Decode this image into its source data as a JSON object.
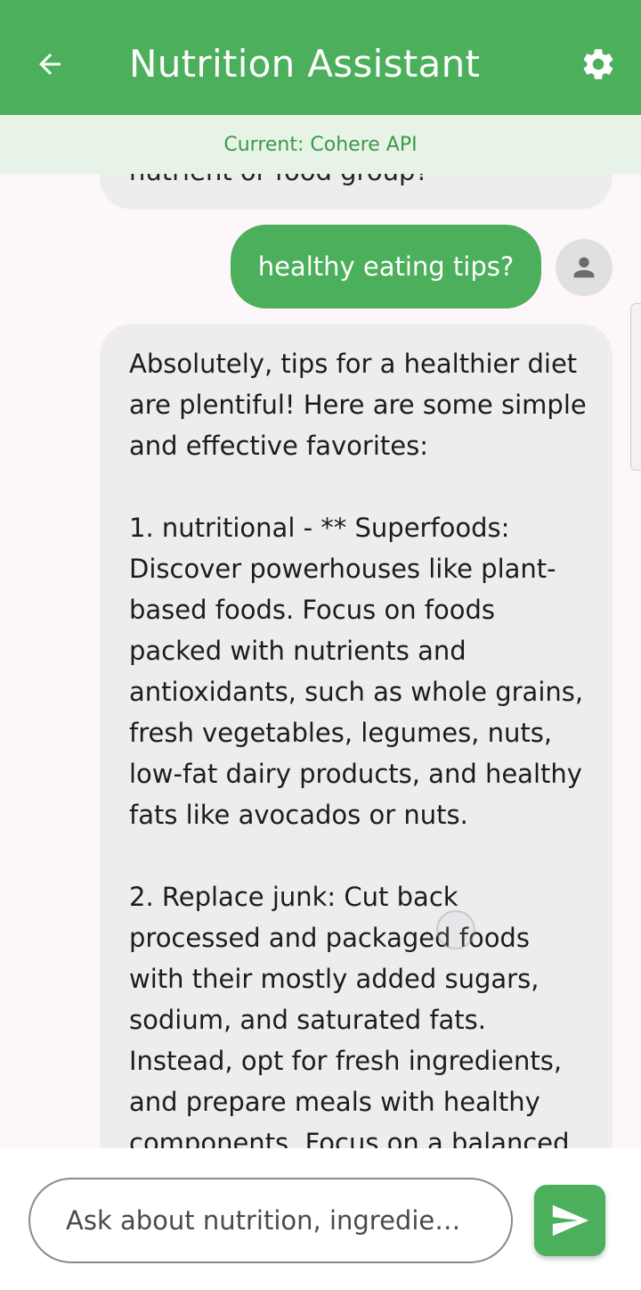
{
  "appbar": {
    "title": "Nutrition Assistant",
    "back_icon": "arrow-back-icon",
    "settings_icon": "gear-icon"
  },
  "status": {
    "text": "Current: Cohere API"
  },
  "chat": {
    "previous_bot_tail": "nutrient or food group?",
    "user_message": "healthy eating tips?",
    "avatar_icon": "person-icon",
    "bot_message": "Absolutely, tips for a healthier diet are plentiful! Here are some simple and effective favorites:\n\n1. nutritional - ** Superfoods: Discover powerhouses like plant-based foods. Focus on foods packed with nutrients and antioxidants, such as whole grains, fresh vegetables, legumes, nuts, low-fat dairy products, and healthy fats like avocados or nuts.\n\n2. Replace junk: Cut back processed and packaged foods with their mostly added sugars, sodium, and saturated fats. Instead, opt for fresh ingredients, and prepare meals with healthy components. Focus on a balanced"
  },
  "input": {
    "placeholder": "Ask about nutrition, ingredie…",
    "value": "",
    "send_icon": "send-icon"
  },
  "colors": {
    "primary": "#4caf5b",
    "status_bg": "#e8f3e8",
    "status_text": "#3a9a48",
    "bot_bubble": "#ededed",
    "page_bg": "#fdf7fc"
  }
}
